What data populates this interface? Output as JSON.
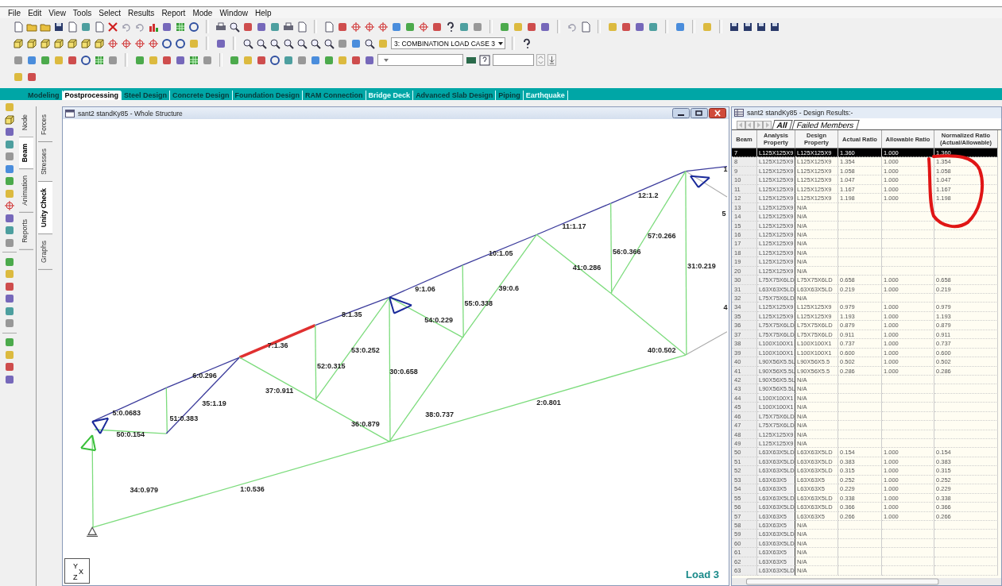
{
  "menu": [
    "File",
    "Edit",
    "View",
    "Tools",
    "Select",
    "Results",
    "Report",
    "Mode",
    "Window",
    "Help"
  ],
  "toolbar": {
    "load_case": "3: COMBINATION LOAD CASE 3"
  },
  "tabs": [
    {
      "label": "Modeling",
      "selected": false,
      "disabled": false
    },
    {
      "label": "Postprocessing",
      "selected": true,
      "disabled": false
    },
    {
      "label": "Steel Design",
      "selected": false,
      "disabled": false
    },
    {
      "label": "Concrete Design",
      "selected": false,
      "disabled": false
    },
    {
      "label": "Foundation Design",
      "selected": false,
      "disabled": false
    },
    {
      "label": "RAM Connection",
      "selected": false,
      "disabled": false
    },
    {
      "label": "Bridge Deck",
      "selected": false,
      "disabled": true
    },
    {
      "label": "Advanced Slab Design",
      "selected": false,
      "disabled": false
    },
    {
      "label": "Piping",
      "selected": false,
      "disabled": false
    },
    {
      "label": "Earthquake",
      "selected": false,
      "disabled": true
    }
  ],
  "side_tabs": {
    "column_1": [
      {
        "label": "Node",
        "selected": false
      },
      {
        "label": "Beam",
        "selected": true
      },
      {
        "label": "Animation",
        "selected": false
      },
      {
        "label": "Reports",
        "selected": false
      }
    ],
    "column_2": [
      {
        "label": "Forces",
        "selected": false
      },
      {
        "label": "Stresses",
        "selected": false
      },
      {
        "label": "Unity Check",
        "selected": true
      },
      {
        "label": "Graphs",
        "selected": false
      }
    ]
  },
  "viewport": {
    "title": "sant2 standKy85 - Whole Structure",
    "members": [
      {
        "label": "5:0.0683",
        "color": "#3c3c9c"
      },
      {
        "label": "6:0.296",
        "color": "#3c3c9c"
      },
      {
        "label": "7:1.36",
        "color": "#e03030"
      },
      {
        "label": "8:1.35",
        "color": "#3c3c9c"
      },
      {
        "label": "9:1.06",
        "color": "#3c3c9c"
      },
      {
        "label": "10:1.05",
        "color": "#3c3c9c"
      },
      {
        "label": "11:1.17",
        "color": "#3c3c9c"
      },
      {
        "label": "12:1.2",
        "color": "#3c3c9c"
      },
      {
        "label": "50:0.154",
        "color": "#7ddc7d"
      },
      {
        "label": "51:0.383",
        "color": "#7ddc7d"
      },
      {
        "label": "35:1.19",
        "color": "#3c3c9c"
      },
      {
        "label": "37:0.911",
        "color": "#7ddc7d"
      },
      {
        "label": "52:0.315",
        "color": "#7ddc7d"
      },
      {
        "label": "53:0.252",
        "color": "#7ddc7d"
      },
      {
        "label": "36:0.879",
        "color": "#7ddc7d"
      },
      {
        "label": "30:0.658",
        "color": "#7ddc7d"
      },
      {
        "label": "54:0.229",
        "color": "#7ddc7d"
      },
      {
        "label": "55:0.338",
        "color": "#7ddc7d"
      },
      {
        "label": "38:0.737",
        "color": "#7ddc7d"
      },
      {
        "label": "39:0.6",
        "color": "#7ddc7d"
      },
      {
        "label": "41:0.286",
        "color": "#7ddc7d"
      },
      {
        "label": "56:0.366",
        "color": "#7ddc7d"
      },
      {
        "label": "57:0.266",
        "color": "#7ddc7d"
      },
      {
        "label": "40:0.502",
        "color": "#7ddc7d"
      },
      {
        "label": "31:0.219",
        "color": "#7ddc7d"
      },
      {
        "label": "34:0.979",
        "color": "#7ddc7d"
      },
      {
        "label": "1:0.536",
        "color": "#7ddc7d"
      },
      {
        "label": "2:0.801",
        "color": "#7ddc7d"
      }
    ],
    "edge_labels": [
      "1",
      "5",
      "4"
    ],
    "axes": [
      "Y",
      "X",
      "Z"
    ],
    "load_label": "Load 3"
  },
  "results": {
    "title": "sant2 standKy85 - Design Results:-",
    "tabs": [
      {
        "label": "All",
        "selected": true
      },
      {
        "label": "Failed Members",
        "selected": false
      }
    ],
    "columns": [
      "Beam",
      "Analysis Property",
      "Design Property",
      "Actual Ratio",
      "Allowable Ratio",
      "Normalized Ratio (Actual/Allowable)"
    ],
    "rows": [
      {
        "cells": [
          "7",
          "L125X125X9",
          "L125X125X9",
          "1.360",
          "1.000",
          "1.360"
        ],
        "selected": true
      },
      {
        "cells": [
          "8",
          "L125X125X9",
          "L125X125X9",
          "1.354",
          "1.000",
          "1.354"
        ],
        "selected": false
      },
      {
        "cells": [
          "9",
          "L125X125X9",
          "L125X125X9",
          "1.058",
          "1.000",
          "1.058"
        ],
        "selected": false
      },
      {
        "cells": [
          "10",
          "L125X125X9",
          "L125X125X9",
          "1.047",
          "1.000",
          "1.047"
        ],
        "selected": false
      },
      {
        "cells": [
          "11",
          "L125X125X9",
          "L125X125X9",
          "1.167",
          "1.000",
          "1.167"
        ],
        "selected": false
      },
      {
        "cells": [
          "12",
          "L125X125X9",
          "L125X125X9",
          "1.198",
          "1.000",
          "1.198"
        ],
        "selected": false
      },
      {
        "cells": [
          "13",
          "L125X125X9",
          "N/A",
          "",
          "",
          ""
        ],
        "selected": false
      },
      {
        "cells": [
          "14",
          "L125X125X9",
          "N/A",
          "",
          "",
          ""
        ],
        "selected": false
      },
      {
        "cells": [
          "15",
          "L125X125X9",
          "N/A",
          "",
          "",
          ""
        ],
        "selected": false
      },
      {
        "cells": [
          "16",
          "L125X125X9",
          "N/A",
          "",
          "",
          ""
        ],
        "selected": false
      },
      {
        "cells": [
          "17",
          "L125X125X9",
          "N/A",
          "",
          "",
          ""
        ],
        "selected": false
      },
      {
        "cells": [
          "18",
          "L125X125X9",
          "N/A",
          "",
          "",
          ""
        ],
        "selected": false
      },
      {
        "cells": [
          "19",
          "L125X125X9",
          "N/A",
          "",
          "",
          ""
        ],
        "selected": false
      },
      {
        "cells": [
          "20",
          "L125X125X9",
          "N/A",
          "",
          "",
          ""
        ],
        "selected": false
      },
      {
        "cells": [
          "30",
          "L75X75X6LD",
          "L75X75X6LD",
          "0.658",
          "1.000",
          "0.658"
        ],
        "selected": false
      },
      {
        "cells": [
          "31",
          "L63X63X5LD",
          "L63X63X5LD",
          "0.219",
          "1.000",
          "0.219"
        ],
        "selected": false
      },
      {
        "cells": [
          "32",
          "L75X75X6LD",
          "N/A",
          "",
          "",
          ""
        ],
        "selected": false
      },
      {
        "cells": [
          "34",
          "L125X125X9",
          "L125X125X9",
          "0.979",
          "1.000",
          "0.979"
        ],
        "selected": false
      },
      {
        "cells": [
          "35",
          "L125X125X9",
          "L125X125X9",
          "1.193",
          "1.000",
          "1.193"
        ],
        "selected": false
      },
      {
        "cells": [
          "36",
          "L75X75X6LD",
          "L75X75X6LD",
          "0.879",
          "1.000",
          "0.879"
        ],
        "selected": false
      },
      {
        "cells": [
          "37",
          "L75X75X6LD",
          "L75X75X6LD",
          "0.911",
          "1.000",
          "0.911"
        ],
        "selected": false
      },
      {
        "cells": [
          "38",
          "L100X100X1",
          "L100X100X1",
          "0.737",
          "1.000",
          "0.737"
        ],
        "selected": false
      },
      {
        "cells": [
          "39",
          "L100X100X1",
          "L100X100X1",
          "0.600",
          "1.000",
          "0.600"
        ],
        "selected": false
      },
      {
        "cells": [
          "40",
          "L90X56X5.5L",
          "L90X56X5.5",
          "0.502",
          "1.000",
          "0.502"
        ],
        "selected": false
      },
      {
        "cells": [
          "41",
          "L90X56X5.5L",
          "L90X56X5.5",
          "0.286",
          "1.000",
          "0.286"
        ],
        "selected": false
      },
      {
        "cells": [
          "42",
          "L90X56X5.5L",
          "N/A",
          "",
          "",
          ""
        ],
        "selected": false
      },
      {
        "cells": [
          "43",
          "L90X56X5.5L",
          "N/A",
          "",
          "",
          ""
        ],
        "selected": false
      },
      {
        "cells": [
          "44",
          "L100X100X1",
          "N/A",
          "",
          "",
          ""
        ],
        "selected": false
      },
      {
        "cells": [
          "45",
          "L100X100X1",
          "N/A",
          "",
          "",
          ""
        ],
        "selected": false
      },
      {
        "cells": [
          "46",
          "L75X75X6LD",
          "N/A",
          "",
          "",
          ""
        ],
        "selected": false
      },
      {
        "cells": [
          "47",
          "L75X75X6LD",
          "N/A",
          "",
          "",
          ""
        ],
        "selected": false
      },
      {
        "cells": [
          "48",
          "L125X125X9",
          "N/A",
          "",
          "",
          ""
        ],
        "selected": false
      },
      {
        "cells": [
          "49",
          "L125X125X9",
          "N/A",
          "",
          "",
          ""
        ],
        "selected": false
      },
      {
        "cells": [
          "50",
          "L63X63X5LD",
          "L63X63X5LD",
          "0.154",
          "1.000",
          "0.154"
        ],
        "selected": false
      },
      {
        "cells": [
          "51",
          "L63X63X5LD",
          "L63X63X5LD",
          "0.383",
          "1.000",
          "0.383"
        ],
        "selected": false
      },
      {
        "cells": [
          "52",
          "L63X63X5LD",
          "L63X63X5LD",
          "0.315",
          "1.000",
          "0.315"
        ],
        "selected": false
      },
      {
        "cells": [
          "53",
          "L63X63X5",
          "L63X63X5",
          "0.252",
          "1.000",
          "0.252"
        ],
        "selected": false
      },
      {
        "cells": [
          "54",
          "L63X63X5",
          "L63X63X5",
          "0.229",
          "1.000",
          "0.229"
        ],
        "selected": false
      },
      {
        "cells": [
          "55",
          "L63X63X5LD",
          "L63X63X5LD",
          "0.338",
          "1.000",
          "0.338"
        ],
        "selected": false
      },
      {
        "cells": [
          "56",
          "L63X63X5LD",
          "L63X63X5LD",
          "0.366",
          "1.000",
          "0.366"
        ],
        "selected": false
      },
      {
        "cells": [
          "57",
          "L63X63X5",
          "L63X63X5",
          "0.266",
          "1.000",
          "0.266"
        ],
        "selected": false
      },
      {
        "cells": [
          "58",
          "L63X63X5",
          "N/A",
          "",
          "",
          ""
        ],
        "selected": false
      },
      {
        "cells": [
          "59",
          "L63X63X5LD",
          "N/A",
          "",
          "",
          ""
        ],
        "selected": false
      },
      {
        "cells": [
          "60",
          "L63X63X5LD",
          "N/A",
          "",
          "",
          ""
        ],
        "selected": false
      },
      {
        "cells": [
          "61",
          "L63X63X5",
          "N/A",
          "",
          "",
          ""
        ],
        "selected": false
      },
      {
        "cells": [
          "62",
          "L63X63X5",
          "N/A",
          "",
          "",
          ""
        ],
        "selected": false
      },
      {
        "cells": [
          "63",
          "L63X63X5LD",
          "N/A",
          "",
          "",
          ""
        ],
        "selected": false
      }
    ]
  }
}
